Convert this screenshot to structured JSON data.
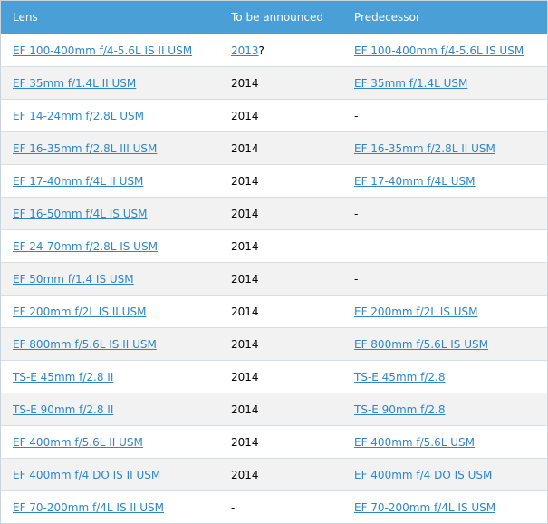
{
  "table": {
    "headers": [
      "Lens",
      "To be announced",
      "Predecessor"
    ],
    "rows": [
      {
        "lens": "EF 100-400mm f/4-5.6L IS II USM",
        "announced": "2013",
        "announced_suffix": "?",
        "announced_link": true,
        "predecessor": "EF 100-400mm f/4-5.6L IS USM",
        "predecessor_link": true
      },
      {
        "lens": "EF 35mm f/1.4L II USM",
        "announced": "2014",
        "announced_suffix": "",
        "announced_link": false,
        "predecessor": "EF 35mm f/1.4L USM",
        "predecessor_link": true
      },
      {
        "lens": "EF 14-24mm f/2.8L USM",
        "announced": "2014",
        "announced_suffix": "",
        "announced_link": false,
        "predecessor": "-",
        "predecessor_link": false
      },
      {
        "lens": "EF 16-35mm f/2.8L III USM",
        "announced": "2014",
        "announced_suffix": "",
        "announced_link": false,
        "predecessor": "EF 16-35mm f/2.8L II USM",
        "predecessor_link": true
      },
      {
        "lens": "EF 17-40mm f/4L II USM",
        "announced": "2014",
        "announced_suffix": "",
        "announced_link": false,
        "predecessor": "EF 17-40mm f/4L USM",
        "predecessor_link": true
      },
      {
        "lens": "EF 16-50mm f/4L IS USM",
        "announced": "2014",
        "announced_suffix": "",
        "announced_link": false,
        "predecessor": "-",
        "predecessor_link": false
      },
      {
        "lens": "EF 24-70mm f/2.8L IS USM",
        "announced": "2014",
        "announced_suffix": "",
        "announced_link": false,
        "predecessor": "-",
        "predecessor_link": false
      },
      {
        "lens": "EF 50mm f/1.4 IS USM",
        "announced": "2014",
        "announced_suffix": "",
        "announced_link": false,
        "predecessor": "-",
        "predecessor_link": false
      },
      {
        "lens": "EF 200mm f/2L IS II USM",
        "announced": "2014",
        "announced_suffix": "",
        "announced_link": false,
        "predecessor": "EF 200mm f/2L IS USM",
        "predecessor_link": true
      },
      {
        "lens": "EF 800mm f/5.6L IS II USM",
        "announced": "2014",
        "announced_suffix": "",
        "announced_link": false,
        "predecessor": "EF 800mm f/5.6L IS USM",
        "predecessor_link": true
      },
      {
        "lens": "TS-E 45mm f/2.8 II",
        "announced": "2014",
        "announced_suffix": "",
        "announced_link": false,
        "predecessor": "TS-E 45mm f/2.8",
        "predecessor_link": true
      },
      {
        "lens": "TS-E 90mm f/2.8 II",
        "announced": "2014",
        "announced_suffix": "",
        "announced_link": false,
        "predecessor": "TS-E 90mm f/2.8",
        "predecessor_link": true
      },
      {
        "lens": "EF 400mm f/5.6L II USM",
        "announced": "2014",
        "announced_suffix": "",
        "announced_link": false,
        "predecessor": "EF 400mm f/5.6L USM",
        "predecessor_link": true
      },
      {
        "lens": "EF 400mm f/4 DO IS II USM",
        "announced": "2014",
        "announced_suffix": "",
        "announced_link": false,
        "predecessor": "EF 400mm f/4 DO IS USM",
        "predecessor_link": true
      },
      {
        "lens": "EF 70-200mm f/4L IS II USM",
        "announced": "-",
        "announced_suffix": "",
        "announced_link": false,
        "predecessor": "EF 70-200mm f/4L IS USM",
        "predecessor_link": true
      }
    ]
  },
  "colors": {
    "header_bg": "#4a9fd6",
    "header_text": "#ffffff",
    "link": "#2f86c6",
    "row_alt_bg": "#f2f2f2",
    "row_border": "#d6dde3"
  }
}
